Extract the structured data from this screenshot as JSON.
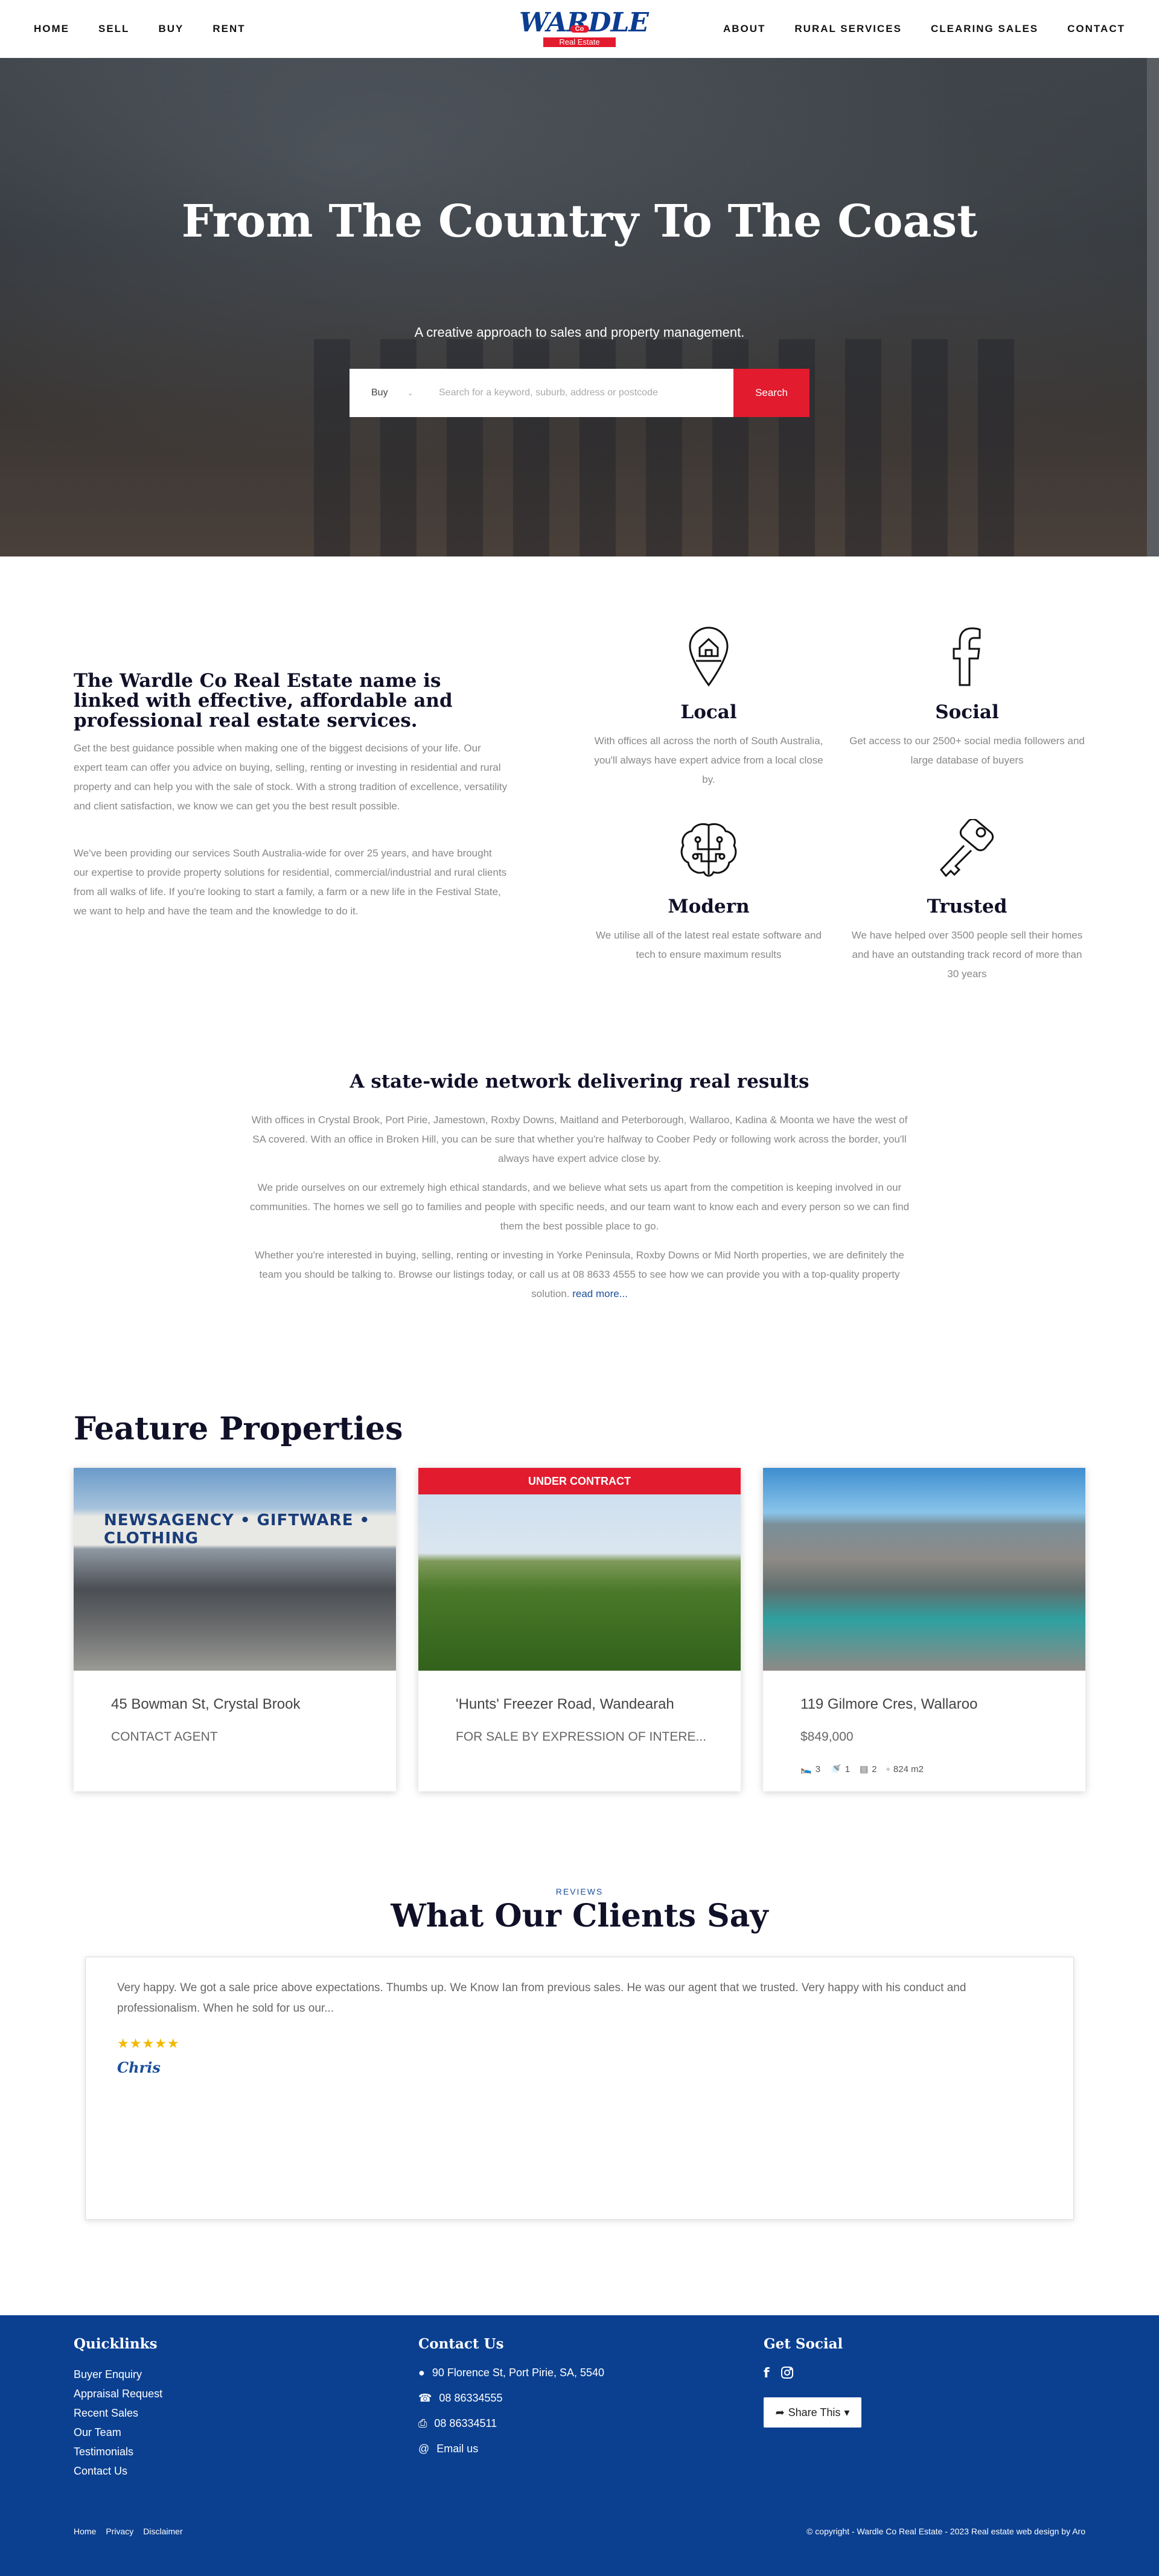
{
  "nav": {
    "left": [
      "HOME",
      "SELL",
      "BUY",
      "RENT"
    ],
    "right": [
      "ABOUT",
      "RURAL SERVICES",
      "CLEARING SALES",
      "CONTACT"
    ],
    "logo": {
      "main": "WARDLE",
      "co": "Co",
      "sub": "Real Estate"
    }
  },
  "hero": {
    "title": "From The Country To The Coast",
    "subtitle": "A creative approach to sales and property management.",
    "search_type": "Buy",
    "search_placeholder": "Search for a keyword, suburb, address or postcode",
    "search_button": "Search"
  },
  "about": {
    "heading": "The Wardle Co Real Estate name is linked with effective, affordable and professional real estate services.",
    "paragraphs": [
      "Get the best guidance possible when making one of the biggest decisions of your life. Our expert team can offer you advice on buying, selling, renting or investing in residential and rural property and can help you with the sale of stock. With a strong tradition of excellence, versatility and client satisfaction, we know we can get you the best result possible.",
      "We've been providing our services South Australia-wide for over 25 years, and have brought our expertise to provide property solutions for residential, commercial/industrial and rural clients from all walks of life. If you're looking to start a family, a farm or a new life in the Festival State, we want to help and have the team and the knowledge to do it."
    ],
    "features": [
      {
        "title": "Local",
        "text": "With offices all across the north of South Australia, you'll always have expert advice from a local close by.",
        "icon": "location-pin-house-icon"
      },
      {
        "title": "Social",
        "text": "Get access to our 2500+ social media followers and large database of buyers",
        "icon": "facebook-icon"
      },
      {
        "title": "Modern",
        "text": "We utilise all of the latest real estate software and tech to ensure maximum results",
        "icon": "brain-circuit-icon"
      },
      {
        "title": "Trusted",
        "text": "We have helped over 3500 people sell their homes and have an outstanding track record of more than 30 years",
        "icon": "key-icon"
      }
    ]
  },
  "network": {
    "heading": "A state-wide network delivering real results",
    "p1": "With offices in Crystal Brook, Port Pirie, Jamestown, Roxby Downs, Maitland and Peterborough, Wallaroo, Kadina & Moonta we have the west of SA covered. With an office in Broken Hill, you can be sure that whether you're halfway to Coober Pedy or following work across the border, you'll always have expert advice close by.",
    "p2": "We pride ourselves on our extremely high ethical standards, and we believe what sets us apart from the competition is keeping involved in our communities. The homes we sell go to families and people with specific needs, and our team want to know each and every person so we can find them the best possible place to go.",
    "p3": "Whether you're interested in buying, selling, renting or investing in Yorke Peninsula, Roxby Downs or Mid North properties, we are definitely the team you should be talking to. Browse our listings today, or call us at 08 8633 4555 to see how we can provide you with a top-quality property solution.",
    "read_more": "read more..."
  },
  "properties": {
    "heading": "Feature Properties",
    "items": [
      {
        "address": "45 Bowman St, Crystal Brook",
        "price": "CONTACT AGENT",
        "badge": "",
        "sign": "NEWSAGENCY • GIFTWARE • CLOTHING"
      },
      {
        "address": "'Hunts' Freezer Road, Wandearah",
        "price": "FOR SALE BY EXPRESSION OF INTERE...",
        "badge": "UNDER CONTRACT"
      },
      {
        "address": "119 Gilmore Cres, Wallaroo",
        "price": "$849,000",
        "badge": "",
        "beds": "3",
        "baths": "1",
        "cars": "2",
        "land": "824 m2"
      }
    ]
  },
  "reviews": {
    "tag": "REVIEWS",
    "heading": "What Our Clients Say",
    "quote": "Very happy. We got a sale price above expectations. Thumbs up. We Know Ian from previous sales. He was our agent that we trusted. Very happy with his conduct and professionalism. When he sold for us our...",
    "stars": "★★★★★",
    "signature": "Chris"
  },
  "footer": {
    "quicklinks_title": "Quicklinks",
    "quicklinks": [
      "Buyer Enquiry",
      "Appraisal Request",
      "Recent Sales",
      "Our Team",
      "Testimonials",
      "Contact Us"
    ],
    "contact_title": "Contact Us",
    "address": "90 Florence St, Port Pirie, SA, 5540",
    "phone": "08 86334555",
    "fax": "08 86334511",
    "email": "Email us",
    "social_title": "Get Social",
    "share": "Share This",
    "bottom_links": [
      "Home",
      "Privacy",
      "Disclaimer"
    ],
    "copyright": "© copyright - Wardle Co Real Estate - 2023 Real estate web design by Aro"
  },
  "colors": {
    "brand_blue": "#0b4091",
    "brand_red": "#e31b2e",
    "heading": "#101028"
  }
}
